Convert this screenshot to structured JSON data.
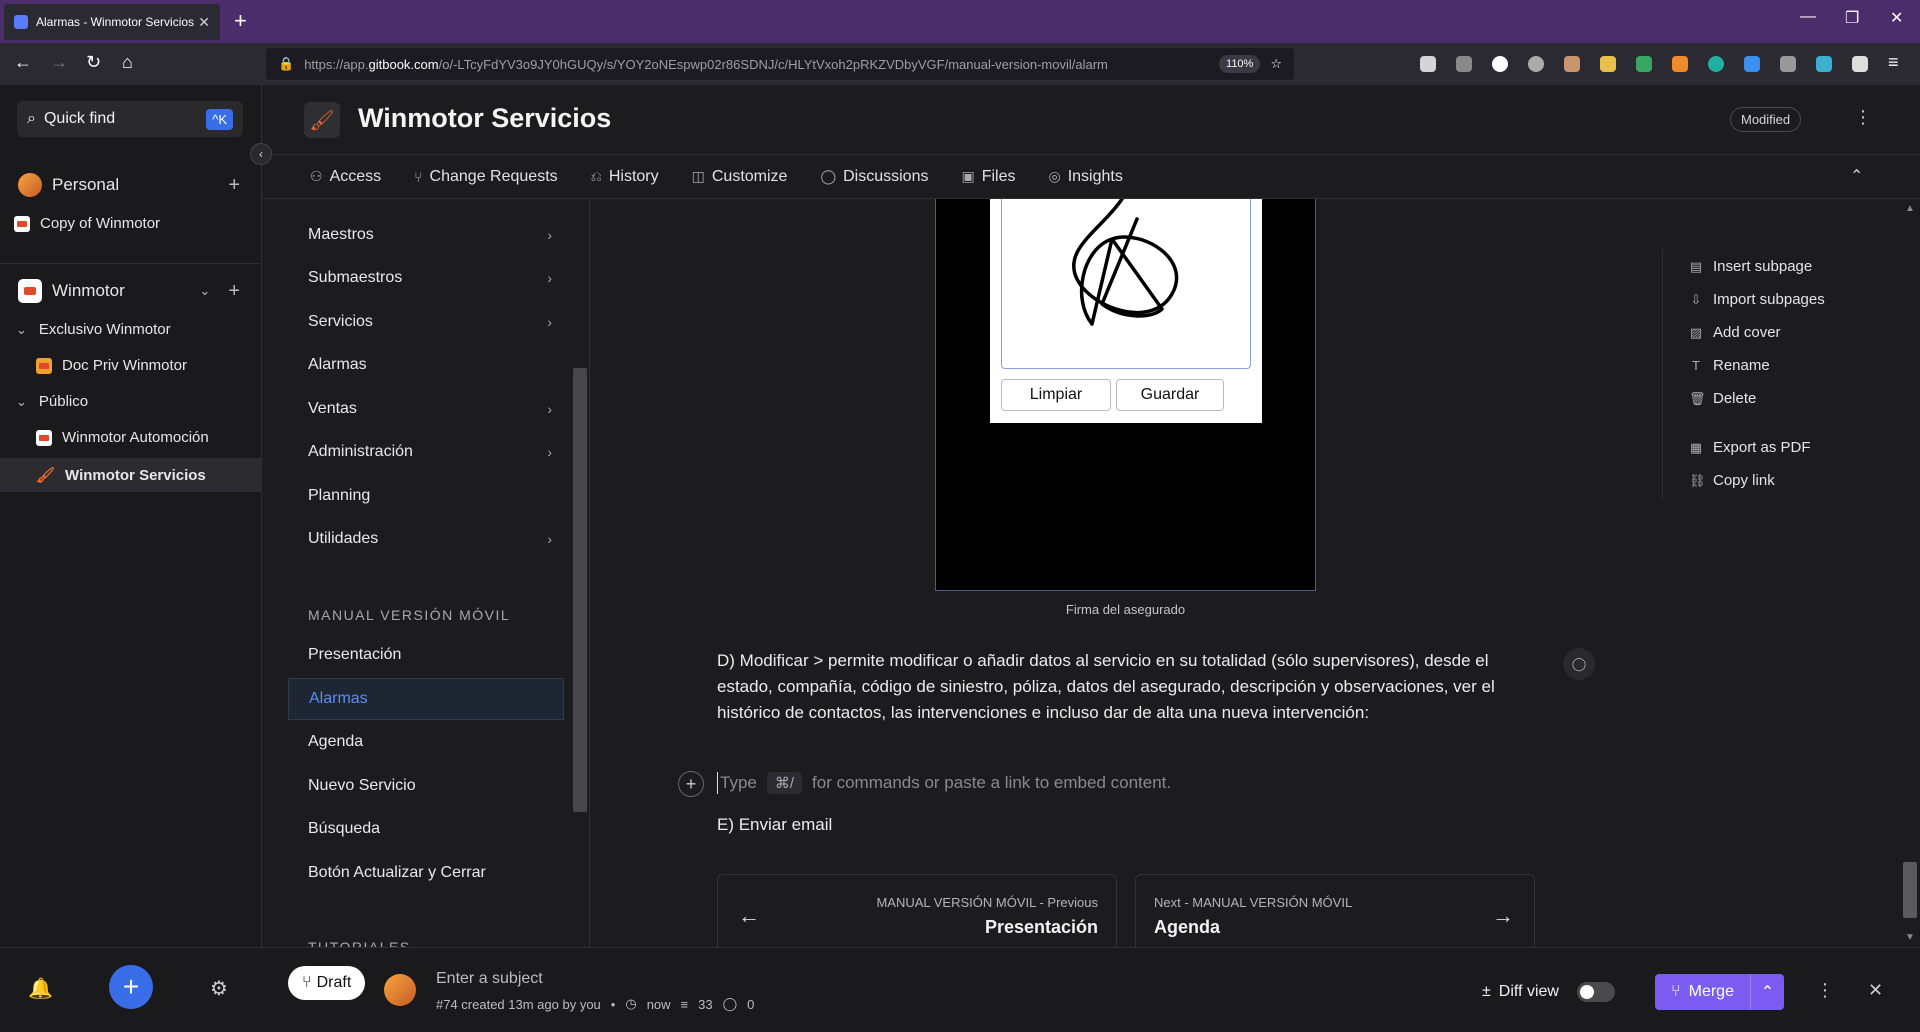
{
  "browser": {
    "tab_title": "Alarmas - Winmotor Servicios",
    "tab_close": "✕",
    "new_tab": "+",
    "url_prefix": "https://app.",
    "url_domain": "gitbook.com",
    "url_rest": "/o/-LTcyFdYV3o9JY0hGUQy/s/YOY2oNEspwp02r86SDNJ/c/HLYtVxoh2pRKZVDbyVGF/manual-version-movil/alarm",
    "zoom": "110%"
  },
  "sidebar": {
    "quick_find": "Quick find",
    "quick_find_kbd": "^K",
    "personal_label": "Personal",
    "personal_item": "Copy of Winmotor",
    "org_label": "Winmotor",
    "group_exclusivo": "Exclusivo Winmotor",
    "doc_priv": "Doc Priv Winmotor",
    "group_publico": "Público",
    "automocion": "Winmotor Automoción",
    "servicios": "Winmotor Servicios"
  },
  "header": {
    "title": "Winmotor Servicios",
    "status": "Modified"
  },
  "tabs": [
    "Access",
    "Change Requests",
    "History",
    "Customize",
    "Discussions",
    "Files",
    "Insights"
  ],
  "pagenav": {
    "items": [
      {
        "label": "Maestros",
        "chevron": true
      },
      {
        "label": "Submaestros",
        "chevron": true
      },
      {
        "label": "Servicios",
        "chevron": true
      },
      {
        "label": "Alarmas",
        "chevron": false
      },
      {
        "label": "Ventas",
        "chevron": true
      },
      {
        "label": "Administración",
        "chevron": true
      },
      {
        "label": "Planning",
        "chevron": false
      },
      {
        "label": "Utilidades",
        "chevron": true
      }
    ],
    "section": "MANUAL VERSIÓN MÓVIL",
    "section_items": [
      "Presentación",
      "Alarmas",
      "Agenda",
      "Nuevo Servicio",
      "Búsqueda",
      "Botón Actualizar y Cerrar"
    ],
    "next_section": "TUTORIALES"
  },
  "content": {
    "btn_limpiar": "Limpiar",
    "btn_guardar": "Guardar",
    "caption": "Firma del asegurado",
    "paragraph": "D) Modificar > permite modificar o añadir datos al servicio en su totalidad (sólo supervisores), desde el estado, compañía, código de siniestro, póliza, datos del asegurado, descripción y observaciones, ver el histórico de contactos, las intervenciones e incluso dar de alta una nueva intervención:",
    "placeholder_type": "Type",
    "placeholder_kbd": "⌘/",
    "placeholder_rest": "for commands or paste a link to embed content.",
    "heading_e": "E) Enviar email",
    "prev_small": "MANUAL VERSIÓN MÓVIL - Previous",
    "prev_big": "Presentación",
    "next_small": "Next - MANUAL VERSIÓN MÓVIL",
    "next_big": "Agenda"
  },
  "actions": [
    "Insert subpage",
    "Import subpages",
    "Add cover",
    "Rename",
    "Delete",
    "Export as PDF",
    "Copy link"
  ],
  "bottom": {
    "draft": "Draft",
    "subject_placeholder": "Enter a subject",
    "cr_meta": "#74 created 13m ago by you",
    "time": "now",
    "lines": "33",
    "comments": "0",
    "diff_view": "Diff view",
    "merge": "Merge"
  }
}
